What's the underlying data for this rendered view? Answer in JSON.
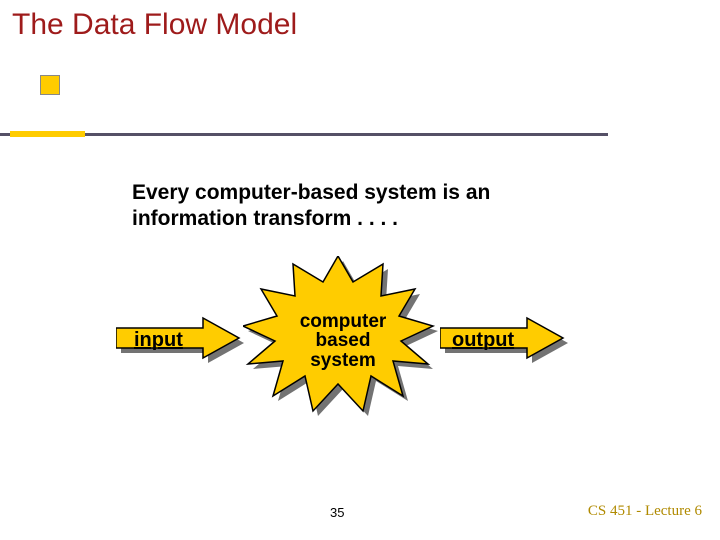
{
  "title": "The Data Flow Model",
  "body_line1": "Every computer-based system is an",
  "body_line2": "information transform . . . .",
  "arrow_input_label": "input",
  "arrow_output_label": "output",
  "star_line1": "computer",
  "star_line2": "based",
  "star_line3": "system",
  "page_number": "35",
  "footer": "CS 451 - Lecture 6",
  "colors": {
    "title": "#9e1b1b",
    "accent": "#ffcc00",
    "rule": "#555066",
    "footer": "#b08a00"
  }
}
